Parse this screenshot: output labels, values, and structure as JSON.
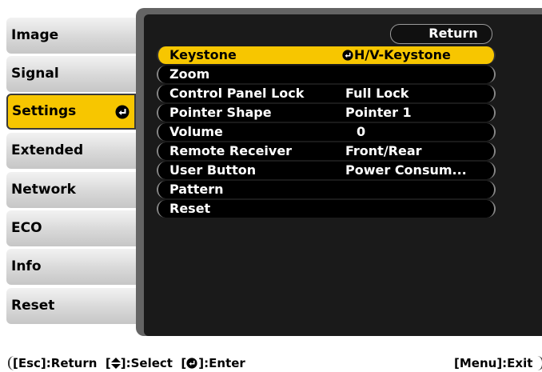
{
  "tabs": [
    {
      "label": "Image",
      "active": false
    },
    {
      "label": "Signal",
      "active": false
    },
    {
      "label": "Settings",
      "active": true
    },
    {
      "label": "Extended",
      "active": false
    },
    {
      "label": "Network",
      "active": false
    },
    {
      "label": "ECO",
      "active": false
    },
    {
      "label": "Info",
      "active": false
    },
    {
      "label": "Reset",
      "active": false
    }
  ],
  "panel": {
    "return_label": "Return",
    "rows": [
      {
        "label": "Keystone",
        "value": "H/V-Keystone",
        "selected": true,
        "value_icon": "enter-icon"
      },
      {
        "label": "Zoom",
        "value": ""
      },
      {
        "label": "Control Panel Lock",
        "value": "Full Lock"
      },
      {
        "label": "Pointer Shape",
        "value": "Pointer 1"
      },
      {
        "label": "Volume",
        "value": "0"
      },
      {
        "label": "Remote Receiver",
        "value": "Front/Rear"
      },
      {
        "label": "User Button",
        "value": "Power Consum..."
      },
      {
        "label": "Pattern",
        "value": ""
      },
      {
        "label": "Reset",
        "value": ""
      }
    ]
  },
  "helpbar": {
    "esc_text": "[Esc]",
    "return_text": ":Return",
    "select_open": "[",
    "select_close": "]",
    "select_text": ":Select",
    "enter_open": "[",
    "enter_close": "]",
    "enter_text": ":Enter",
    "exit_text": "[Menu]:Exit"
  },
  "colors": {
    "accent": "#f7c600",
    "panel": "#646464",
    "row_bg": "#000000"
  }
}
